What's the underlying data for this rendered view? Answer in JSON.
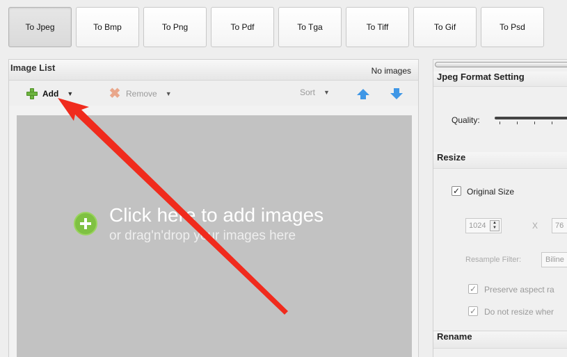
{
  "tabs": [
    {
      "label": "To Jpeg",
      "active": true
    },
    {
      "label": "To Bmp"
    },
    {
      "label": "To Png"
    },
    {
      "label": "To Pdf"
    },
    {
      "label": "To Tga"
    },
    {
      "label": "To Tiff"
    },
    {
      "label": "To Gif"
    },
    {
      "label": "To Psd"
    }
  ],
  "image_list": {
    "title": "Image List",
    "status": "No images",
    "toolbar": {
      "add_label": "Add",
      "remove_label": "Remove",
      "sort_label": "Sort",
      "caret": "▼"
    },
    "drop_zone": {
      "main_text": "Click here  to add images",
      "sub_text": "or drag'n'drop your images here"
    }
  },
  "settings": {
    "jpeg_section_title": "Jpeg Format Setting",
    "quality_label": "Quality:",
    "resize_section_title": "Resize",
    "original_size_label": "Original Size",
    "original_size_checked": true,
    "width_value": "1024",
    "x_separator": "X",
    "height_value": "76",
    "resample_filter_label": "Resample Filter:",
    "resample_filter_value": "Biline",
    "preserve_aspect_label": "Preserve aspect ra",
    "do_not_resize_label": "Do not resize wher",
    "checkmark": "✓",
    "rename_section_title": "Rename"
  },
  "colors": {
    "annotation_arrow": "#f02b1d",
    "drop_zone_bg": "#c2c2c2",
    "accent_green": "#7fc142",
    "accent_blue": "#3f97e6"
  }
}
